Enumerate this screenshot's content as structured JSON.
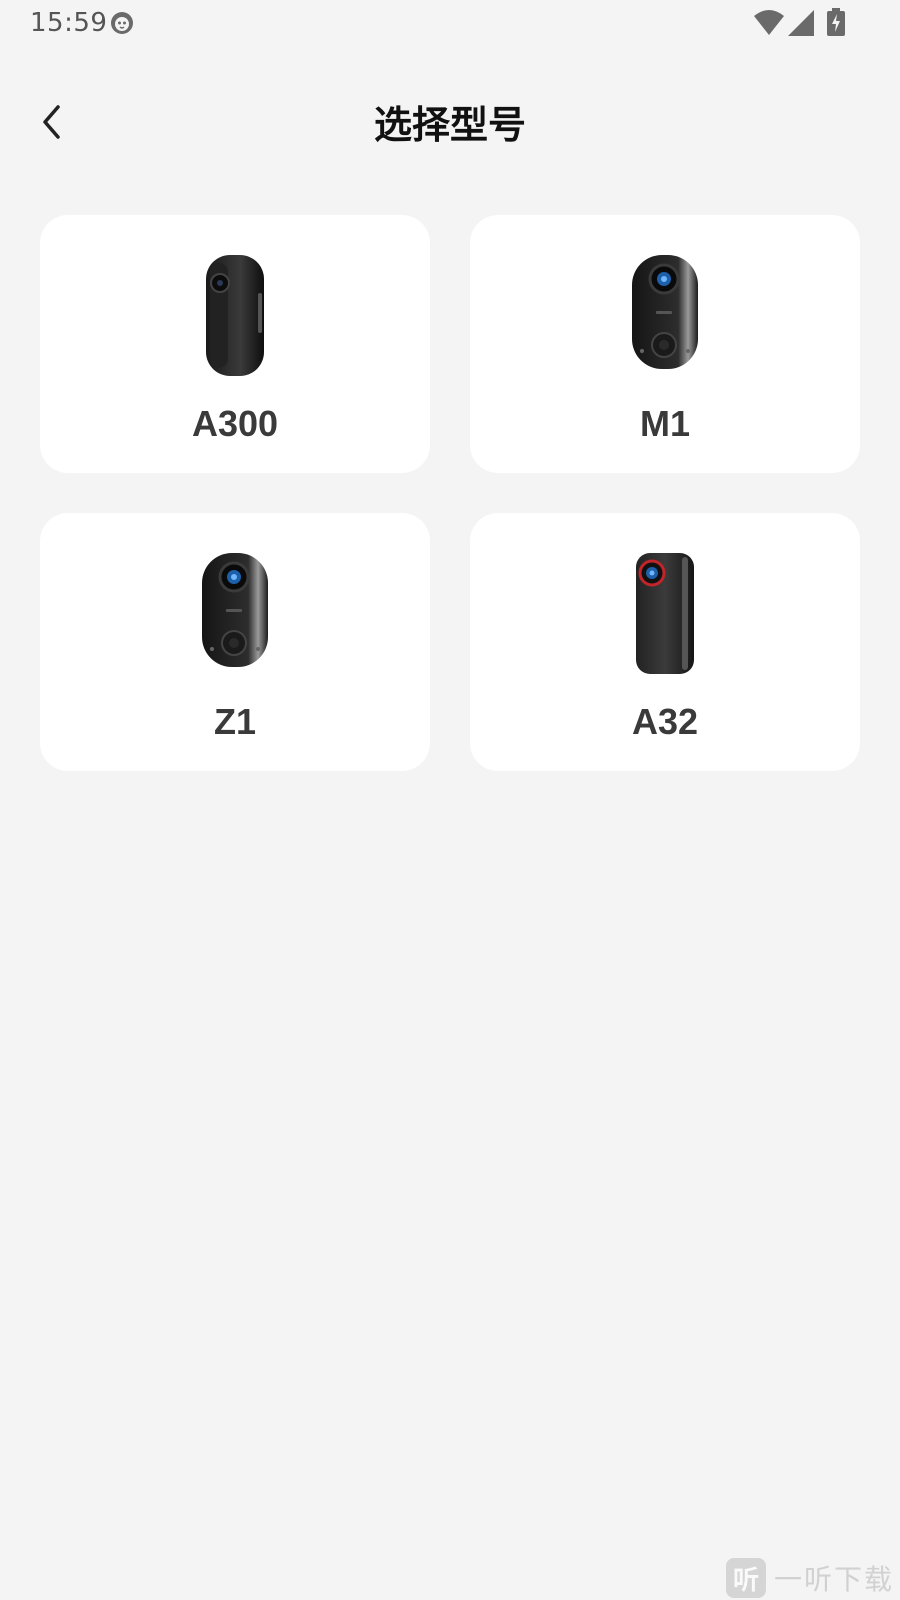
{
  "status_bar": {
    "time": "15:59",
    "app_icon": "cat-face-icon",
    "icons": [
      "wifi-icon",
      "signal-icon",
      "battery-charging-icon"
    ]
  },
  "header": {
    "back_icon": "chevron-left-icon",
    "title": "选择型号"
  },
  "models": [
    {
      "name": "A300",
      "image": "camera-a300"
    },
    {
      "name": "M1",
      "image": "camera-m1"
    },
    {
      "name": "Z1",
      "image": "camera-z1"
    },
    {
      "name": "A32",
      "image": "camera-a32"
    }
  ],
  "watermark": {
    "logo_char": "听",
    "text": "一听下载"
  },
  "colors": {
    "background": "#f4f4f4",
    "card": "#ffffff",
    "title": "#111111",
    "label": "#3a3a3a"
  }
}
